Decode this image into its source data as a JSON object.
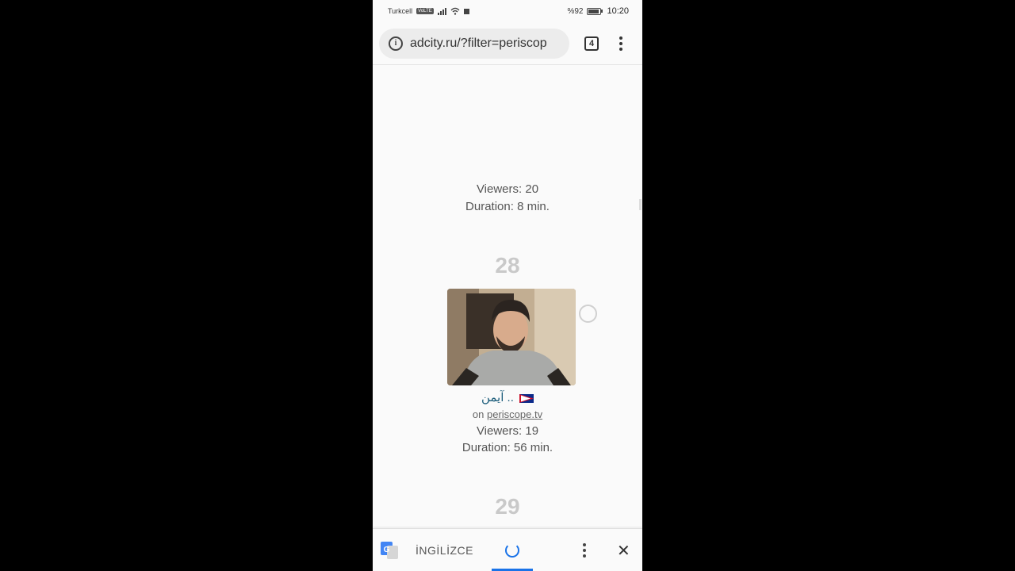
{
  "status_bar": {
    "carrier": "Turkcell",
    "volte": "VoLTE",
    "battery_percent": "%92",
    "battery_level": 0.92,
    "time": "10:20"
  },
  "browser": {
    "url": "adcity.ru/?filter=periscop",
    "tab_count": "4",
    "info_icon": "info-icon",
    "menu_icon": "more-vert-icon"
  },
  "content": {
    "prev_item": {
      "viewers": "Viewers: 20",
      "duration": "Duration: 8 min."
    },
    "item_28": {
      "rank": "28",
      "name": "آيمن ..",
      "source_prefix": "on ",
      "source_link": "periscope.tv",
      "viewers": "Viewers: 19",
      "duration": "Duration: 56 min."
    },
    "next_rank": "29"
  },
  "translate_bar": {
    "language": "İNGİLİZCE",
    "accent_color": "#1a73e8"
  }
}
